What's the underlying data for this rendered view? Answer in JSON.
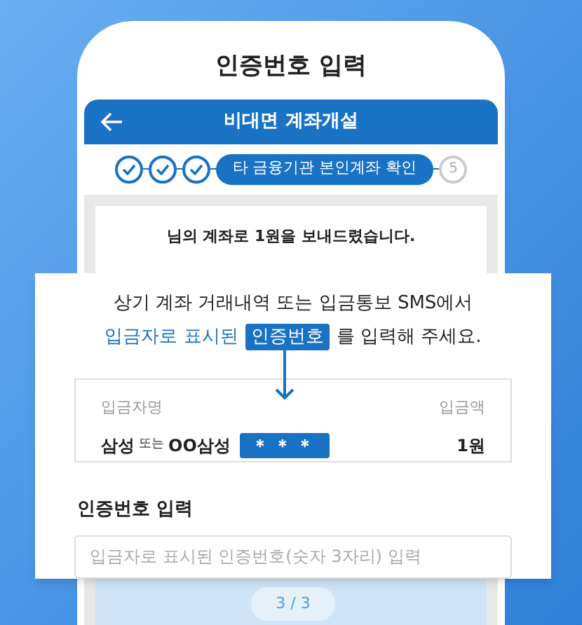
{
  "screen_title": "인증번호 입력",
  "app_header": {
    "title": "비대면 계좌개설"
  },
  "steps": [
    {
      "kind": "done"
    },
    {
      "kind": "done"
    },
    {
      "kind": "done"
    },
    {
      "kind": "current",
      "label": "타 금융기관 본인계좌 확인"
    },
    {
      "kind": "pending",
      "label": "5"
    }
  ],
  "message": "님의 계좌로 1원을 보내드렸습니다.",
  "instruction": {
    "line1": "상기 계좌 거래내역 또는 입금통보 SMS에서",
    "highlight": "입금자로 표시된",
    "badge": "인증번호",
    "rest": "를 입력해 주세요."
  },
  "example": {
    "name_label": "입금자명",
    "amount_label": "입금액",
    "name_main": "삼성",
    "name_or": "또는",
    "name_alt": "OO삼성",
    "code": "＊＊＊",
    "amount": "1원"
  },
  "input": {
    "label": "인증번호 입력",
    "placeholder": "입금자로 표시된 인증번호(숫자 3자리) 입력"
  },
  "pager": "3 / 3"
}
